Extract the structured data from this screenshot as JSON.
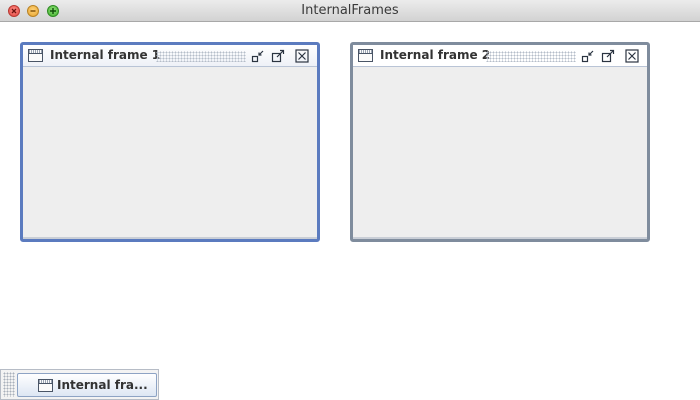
{
  "window": {
    "title": "InternalFrames"
  },
  "frames": [
    {
      "title": "Internal frame 1",
      "state": "active"
    },
    {
      "title": "Internal frame 2",
      "state": "inactive"
    }
  ],
  "taskbar": {
    "items": [
      {
        "label": "Internal fra..."
      }
    ]
  },
  "colors": {
    "active_border": "#5b7bbf",
    "inactive_border": "#7f8c9d",
    "frame_body": "#eeeeee",
    "desktop": "#ffffff"
  },
  "icons": {
    "frame_icon": "window-icon",
    "minimize": "iconify-icon",
    "maximize": "maximize-icon",
    "close": "close-icon"
  }
}
